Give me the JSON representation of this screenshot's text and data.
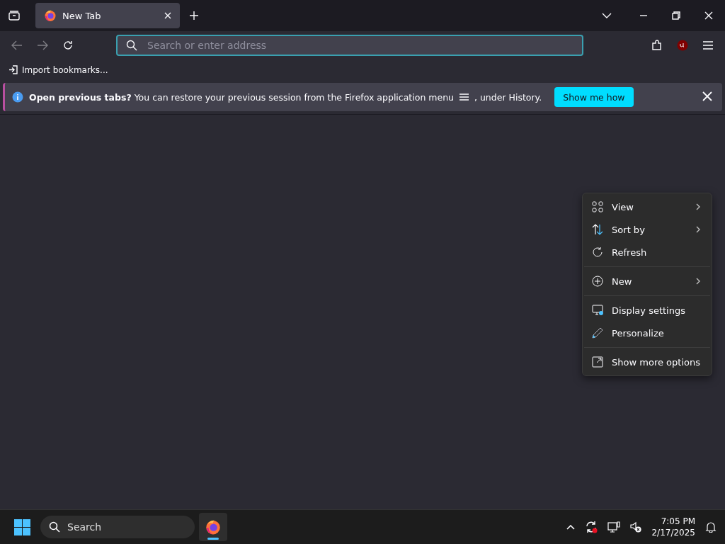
{
  "tabs": [
    {
      "title": "New Tab",
      "selected": true
    }
  ],
  "address_bar": {
    "placeholder": "Search or enter address"
  },
  "bookmarks_bar": {
    "items": [
      {
        "label": "Import bookmarks..."
      }
    ]
  },
  "notification": {
    "message": "**Open previous tabs?** You can restore your previous session from the Firefox application menu",
    "message_end": ", under History.",
    "button": "Show me how"
  },
  "context_menu": {
    "groups": [
      [
        {
          "label": "View",
          "submenu": true
        },
        {
          "label": "Sort by",
          "submenu": true
        },
        {
          "label": "Refresh",
          "submenu": false
        }
      ],
      [
        {
          "label": "New",
          "submenu": true
        }
      ],
      [
        {
          "label": "Display settings",
          "submenu": false
        },
        {
          "label": "Personalize",
          "submenu": false
        }
      ],
      [
        {
          "label": "Show more options",
          "submenu": false
        }
      ]
    ]
  },
  "taskbar": {
    "search_placeholder": "Search",
    "apps": [
      {
        "selected": true
      }
    ],
    "time": "7:05 PM",
    "date": "2/17/2025"
  }
}
